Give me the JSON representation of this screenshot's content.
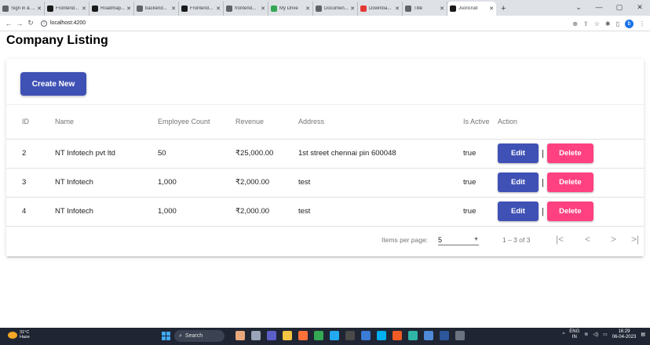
{
  "browser": {
    "tabs": [
      {
        "title": "Sign in & ...",
        "icon": "globe-icon",
        "color": "#5f6368",
        "active": false
      },
      {
        "title": "Frontend...",
        "icon": "f-icon",
        "color": "#1a1a1a",
        "active": false
      },
      {
        "title": "Roadmap...",
        "icon": "f-icon",
        "color": "#1a1a1a",
        "active": false
      },
      {
        "title": "backend...",
        "icon": "globe-icon",
        "color": "#5f6368",
        "active": false
      },
      {
        "title": "Frontend...",
        "icon": "f-icon",
        "color": "#1a1a1a",
        "active": false
      },
      {
        "title": "frontend...",
        "icon": "globe-icon",
        "color": "#5f6368",
        "active": false
      },
      {
        "title": "My Drive",
        "icon": "drive-icon",
        "color": "#34a853",
        "active": false
      },
      {
        "title": "Documen...",
        "icon": "globe-icon",
        "color": "#5f6368",
        "active": false
      },
      {
        "title": "Downloa...",
        "icon": "download-icon",
        "color": "#e53935",
        "active": false
      },
      {
        "title": "Title",
        "icon": "globe-icon",
        "color": "#5f6368",
        "active": false
      },
      {
        "title": "Jsoncrud",
        "icon": "angular-icon",
        "color": "#1a1a1a",
        "active": true
      }
    ],
    "new_tab": "+",
    "url": "localhost:4200",
    "profile_initial": "b"
  },
  "page": {
    "title": "Company Listing",
    "create_button": "Create New"
  },
  "table": {
    "headers": {
      "id": "ID",
      "name": "Name",
      "employee_count": "Employee Count",
      "revenue": "Revenue",
      "address": "Address",
      "is_active": "Is Active",
      "action": "Action"
    },
    "rows": [
      {
        "id": "2",
        "name": "NT Infotech pvt ltd",
        "employee_count": "50",
        "revenue": "₹25,000.00",
        "address": "1st street chennai pin 600048",
        "is_active": "true"
      },
      {
        "id": "3",
        "name": "NT Infotech",
        "employee_count": "1,000",
        "revenue": "₹2,000.00",
        "address": "test",
        "is_active": "true"
      },
      {
        "id": "4",
        "name": "NT Infotech",
        "employee_count": "1,000",
        "revenue": "₹2,000.00",
        "address": "test",
        "is_active": "true"
      }
    ],
    "edit_label": "Edit",
    "delete_label": "Delete",
    "separator": "|"
  },
  "paginator": {
    "items_per_page_label": "Items per page:",
    "page_size": "5",
    "range_label": "1 – 3 of 3"
  },
  "taskbar": {
    "temperature": "31°C",
    "weather": "Haze",
    "search_placeholder": "Search",
    "language": "ENG",
    "region": "IN",
    "time": "16:29",
    "date": "06-04-2023"
  },
  "colors": {
    "primary": "#3f51b5",
    "accent": "#ff4081"
  }
}
